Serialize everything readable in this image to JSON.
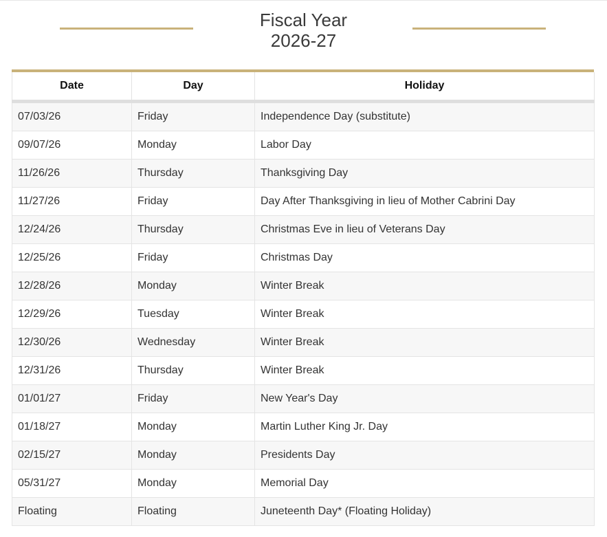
{
  "heading": {
    "title_line1": "Fiscal Year",
    "title_line2": "2026-27",
    "accent_color": "#c9b27a"
  },
  "table": {
    "headers": {
      "date": "Date",
      "day": "Day",
      "holiday": "Holiday"
    },
    "rows": [
      {
        "date": "07/03/26",
        "day": "Friday",
        "holiday": "Independence Day (substitute)"
      },
      {
        "date": "09/07/26",
        "day": "Monday",
        "holiday": "Labor Day"
      },
      {
        "date": "11/26/26",
        "day": "Thursday",
        "holiday": "Thanksgiving Day"
      },
      {
        "date": "11/27/26",
        "day": "Friday",
        "holiday": "Day After Thanksgiving in lieu of Mother Cabrini Day"
      },
      {
        "date": "12/24/26",
        "day": "Thursday",
        "holiday": "Christmas Eve in lieu of Veterans Day"
      },
      {
        "date": "12/25/26",
        "day": "Friday",
        "holiday": "Christmas Day"
      },
      {
        "date": "12/28/26",
        "day": "Monday",
        "holiday": "Winter Break"
      },
      {
        "date": "12/29/26",
        "day": "Tuesday",
        "holiday": "Winter Break"
      },
      {
        "date": "12/30/26",
        "day": "Wednesday",
        "holiday": "Winter Break"
      },
      {
        "date": "12/31/26",
        "day": "Thursday",
        "holiday": "Winter Break"
      },
      {
        "date": "01/01/27",
        "day": "Friday",
        "holiday": "New Year's Day"
      },
      {
        "date": "01/18/27",
        "day": "Monday",
        "holiday": "Martin Luther King Jr. Day"
      },
      {
        "date": "02/15/27",
        "day": "Monday",
        "holiday": "Presidents Day"
      },
      {
        "date": "05/31/27",
        "day": "Monday",
        "holiday": "Memorial Day"
      },
      {
        "date": "Floating",
        "day": "Floating",
        "holiday": "Juneteenth Day* (Floating Holiday)"
      }
    ]
  }
}
